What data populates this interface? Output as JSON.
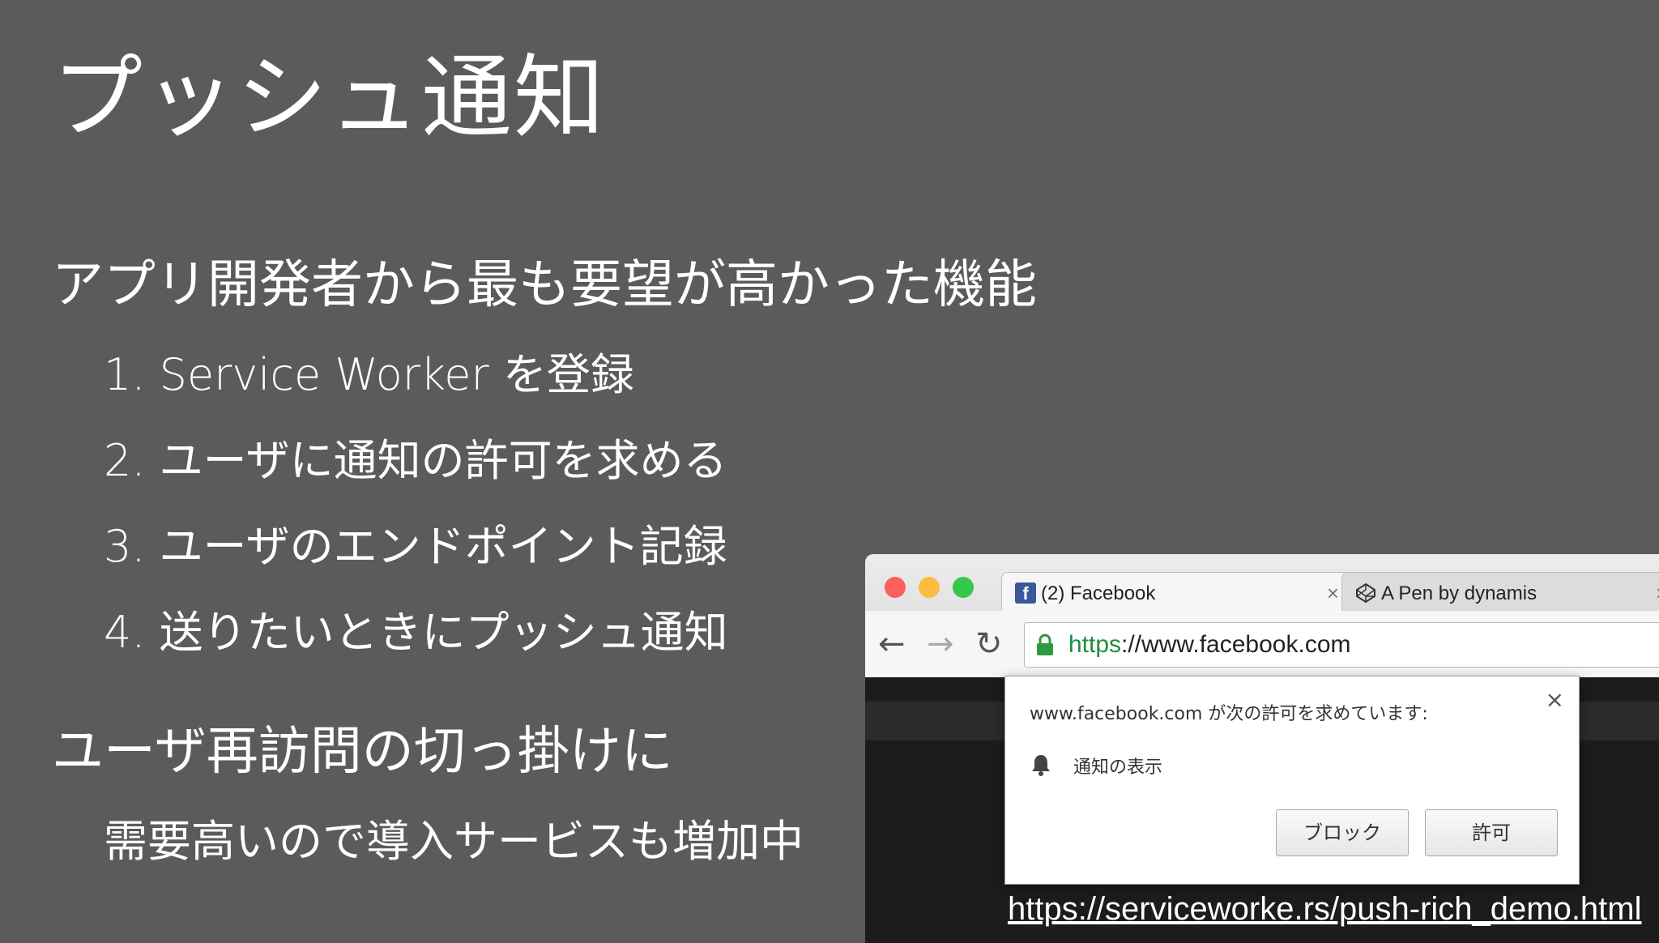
{
  "slide": {
    "title": "プッシュ通知",
    "bullet1": "アプリ開発者から最も要望が高かった機能",
    "steps": [
      "1. Service Worker を登録",
      "2. ユーザに通知の許可を求める",
      "3. ユーザのエンドポイント記録",
      "4. 送りたいときにプッシュ通知"
    ],
    "bullet2": "ユーザ再訪問の切っ掛けに",
    "sub2": "需要高いので導入サービスも増加中",
    "link": "https://serviceworke.rs/push-rich_demo.html"
  },
  "browser": {
    "tabs": [
      {
        "title": "(2) Facebook",
        "icon": "facebook-icon",
        "close": "×"
      },
      {
        "title": "A Pen by dynamis",
        "icon": "codepen-icon",
        "close": "×"
      }
    ],
    "url_scheme": "https",
    "url_rest": "://www.facebook.com",
    "nav": {
      "back": "←",
      "forward": "→",
      "reload": "↻"
    },
    "popup": {
      "message": "www.facebook.com が次の許可を求めています:",
      "permission": "通知の表示",
      "block_label": "ブロック",
      "allow_label": "許可",
      "close": "×"
    }
  }
}
